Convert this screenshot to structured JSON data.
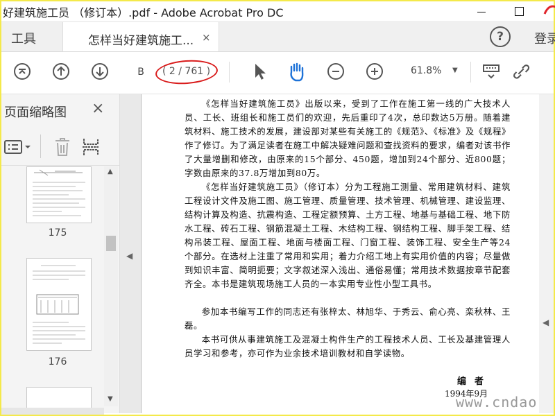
{
  "window": {
    "title": "好建筑施工员 （修订本）.pdf - Adobe Acrobat Pro DC"
  },
  "tabs": {
    "tools_label": "工具",
    "document_label": "怎样当好建筑施工...",
    "close_glyph": "×",
    "help_glyph": "?",
    "login_label": "登录"
  },
  "toolbar": {
    "page_input_value": "B",
    "page_count": "( 2 / 761 )",
    "zoom_value": "61.8%",
    "highlight_color": "#d91c1c",
    "icons": [
      "first-page-icon",
      "prev-page-icon",
      "next-page-icon",
      "select-arrow-icon",
      "hand-tool-icon",
      "zoom-out-icon",
      "zoom-in-icon",
      "scroll-mode-icon",
      "link-icon"
    ]
  },
  "sidebar": {
    "title": "页面缩略图",
    "close_glyph": "×",
    "thumbnails": [
      {
        "page_label": "175"
      },
      {
        "page_label": "176"
      }
    ]
  },
  "document": {
    "paragraphs": [
      "《怎样当好建筑施工员》出版以来，受到了工作在施工第一线的广大技术人员、工长、班组长和施工员们的欢迎，先后重印了4次，总印数达5万册。随着建筑材料、施工技术的发展，建设部对某些有关施工的《规范》、《标准》及《规程》作了修订。为了满足读者在施工中解决疑难问题和查找资料的要求，编者对该书作了大量增删和修改，由原来的15个部分、450题，增加到24个部分、近800题；字数由原来的37.8万增加到80万。",
      "《怎样当好建筑施工员》（修订本）分为工程施工测量、常用建筑材料、建筑工程设计文件及施工图、施工管理、质量管理、技术管理、机械管理、建设监理、结构计算及构造、抗震构造、工程定额预算、土方工程、地基与基础工程、地下防水工程、砖石工程、钢筋混凝土工程、木结构工程、钢结构工程、脚手架工程、结构吊装工程、屋面工程、地面与楼面工程、门窗工程、装饰工程、安全生产等24个部分。在选材上注重了常用和实用；着力介绍工地上有实用价值的内容；尽量做到知识丰富、简明扼要；文字叙述深入浅出、通俗易懂；常用技术数据按章节配套齐全。本书是建筑现场施工人员的一本实用专业性小型工具书。",
      "参加本书编写工作的同志还有张梓太、林旭华、于秀云、俞心亮、栾秋林、王磊。",
      "本书可供从事建筑施工及混凝土构件生产的工程技术人员、工长及基建管理人员学习和参考，亦可作为业余技术培训教材和自学读物。"
    ],
    "signature": "编者",
    "date": "1994年9月",
    "watermark": "www.cndao.com"
  }
}
